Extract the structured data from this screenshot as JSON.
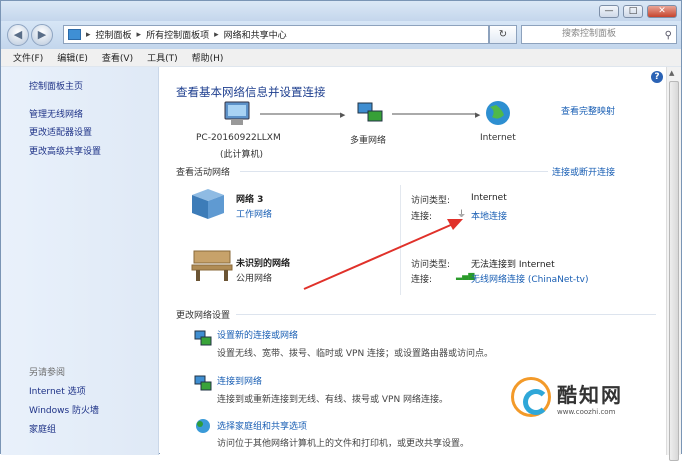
{
  "window": {
    "min": "—",
    "max": "□",
    "close": "✕"
  },
  "nav": {
    "back": "◀",
    "forward": "▶",
    "breadcrumbs": [
      "控制面板",
      "所有控制面板项",
      "网络和共享中心"
    ],
    "refresh": "↻",
    "search_placeholder": "搜索控制面板"
  },
  "menu": [
    "文件(F)",
    "编辑(E)",
    "查看(V)",
    "工具(T)",
    "帮助(H)"
  ],
  "sidebar": {
    "home": "控制面板主页",
    "items": [
      "管理无线网络",
      "更改适配器设置",
      "更改高级共享设置"
    ],
    "see_also_title": "另请参阅",
    "see_also": [
      "Internet 选项",
      "Windows 防火墙",
      "家庭组"
    ]
  },
  "main": {
    "title": "查看基本网络信息并设置连接",
    "view_full_map": "查看完整映射",
    "map": {
      "computer": "PC-20160922LLXM",
      "computer_sub": "(此计算机)",
      "middle": "多重网络",
      "internet": "Internet"
    },
    "active_header": "查看活动网络",
    "connect_disconnect": "连接或断开连接",
    "networks": [
      {
        "name": "网络 3",
        "type": "工作网络",
        "access_label": "访问类型:",
        "access": "Internet",
        "conn_label": "连接:",
        "conn": "本地连接"
      },
      {
        "name": "未识别的网络",
        "type": "公用网络",
        "access_label": "访问类型:",
        "access": "无法连接到 Internet",
        "conn_label": "连接:",
        "conn": "无线网络连接 (ChinaNet-tv)"
      }
    ],
    "change_header": "更改网络设置",
    "tasks": [
      {
        "title": "设置新的连接或网络",
        "desc": "设置无线、宽带、拨号、临时或 VPN 连接；或设置路由器或访问点。"
      },
      {
        "title": "连接到网络",
        "desc": "连接到或重新连接到无线、有线、拨号或 VPN 网络连接。"
      },
      {
        "title": "选择家庭组和共享选项",
        "desc": "访问位于其他网络计算机上的文件和打印机，或更改共享设置。"
      }
    ]
  },
  "watermark": {
    "title": "酷知网",
    "url": "www.coozhi.com"
  },
  "colors": {
    "link": "#1a5fb4",
    "title": "#1e3f8f",
    "arrow": "#e0312a"
  }
}
